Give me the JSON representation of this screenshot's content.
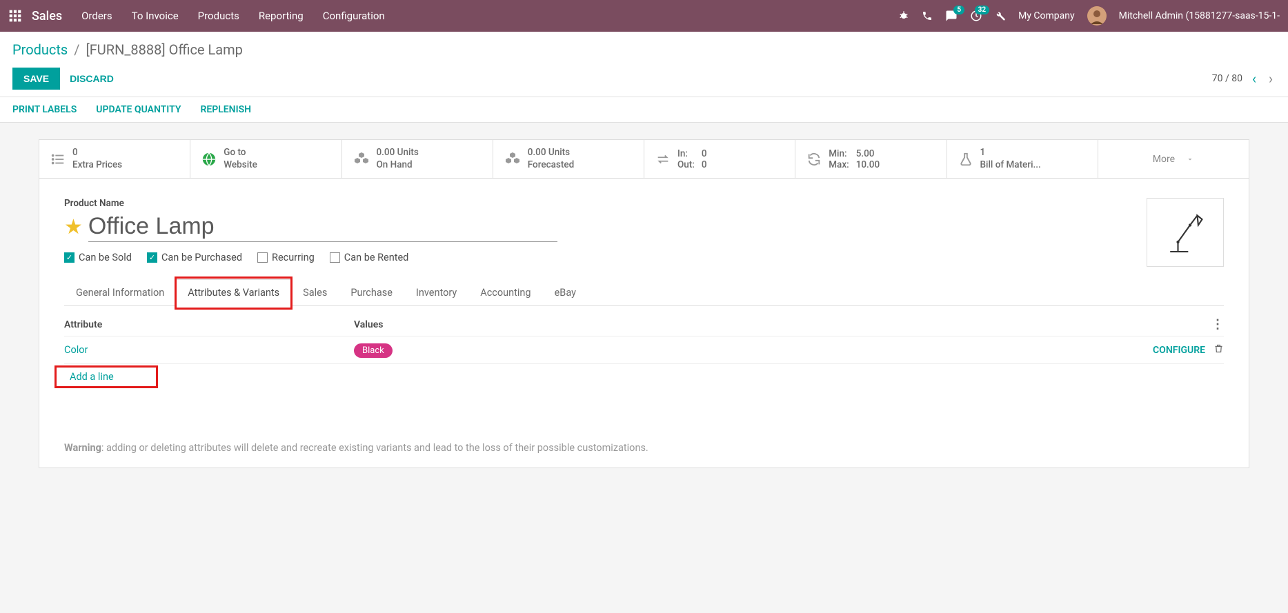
{
  "topbar": {
    "app": "Sales",
    "menu": [
      "Orders",
      "To Invoice",
      "Products",
      "Reporting",
      "Configuration"
    ],
    "chat_badge": "5",
    "activity_badge": "32",
    "company": "My Company",
    "user": "Mitchell Admin (15881277-saas-15-1-"
  },
  "breadcrumb": {
    "parent": "Products",
    "current": "[FURN_8888] Office Lamp"
  },
  "buttons": {
    "save": "SAVE",
    "discard": "DISCARD"
  },
  "pager": {
    "text": "70 / 80"
  },
  "subbar": [
    "PRINT LABELS",
    "UPDATE QUANTITY",
    "REPLENISH"
  ],
  "stats": {
    "extra": {
      "n": "0",
      "label": "Extra Prices"
    },
    "website": {
      "l1": "Go to",
      "l2": "Website"
    },
    "onhand": {
      "l1": "0.00 Units",
      "l2": "On Hand"
    },
    "forecast": {
      "l1": "0.00 Units",
      "l2": "Forecasted"
    },
    "inout": {
      "in_l": "In:",
      "in_v": "0",
      "out_l": "Out:",
      "out_v": "0"
    },
    "minmax": {
      "min_l": "Min:",
      "min_v": "5.00",
      "max_l": "Max:",
      "max_v": "10.00"
    },
    "bom": {
      "n": "1",
      "label": "Bill of Materi..."
    },
    "more": "More"
  },
  "product": {
    "label": "Product Name",
    "name": "Office Lamp"
  },
  "checks": {
    "sold": "Can be Sold",
    "purchased": "Can be Purchased",
    "recurring": "Recurring",
    "rented": "Can be Rented"
  },
  "tabs": [
    "General Information",
    "Attributes & Variants",
    "Sales",
    "Purchase",
    "Inventory",
    "Accounting",
    "eBay"
  ],
  "attr": {
    "col1": "Attribute",
    "col2": "Values",
    "row_attr": "Color",
    "row_val": "Black",
    "configure": "CONFIGURE",
    "addline": "Add a line"
  },
  "warning": {
    "label": "Warning",
    "text": ": adding or deleting attributes will delete and recreate existing variants and lead to the loss of their possible customizations."
  }
}
